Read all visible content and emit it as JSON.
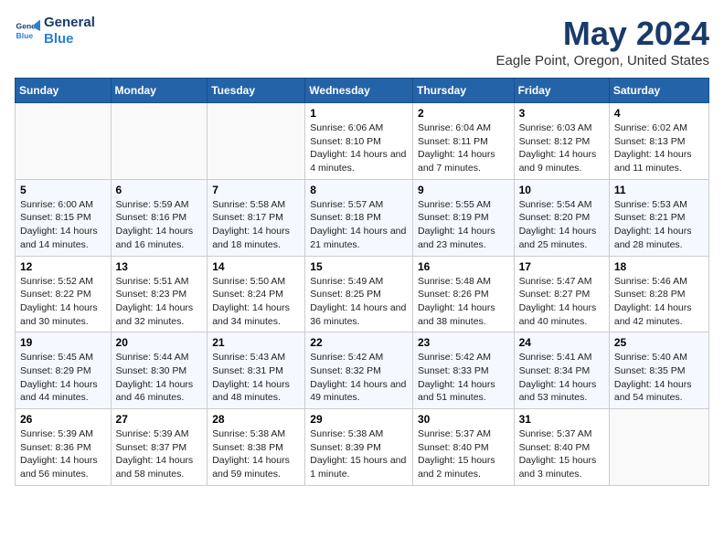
{
  "logo": {
    "line1": "General",
    "line2": "Blue"
  },
  "title": "May 2024",
  "subtitle": "Eagle Point, Oregon, United States",
  "days_header": [
    "Sunday",
    "Monday",
    "Tuesday",
    "Wednesday",
    "Thursday",
    "Friday",
    "Saturday"
  ],
  "weeks": [
    [
      {
        "day": "",
        "sunrise": "",
        "sunset": "",
        "daylight": ""
      },
      {
        "day": "",
        "sunrise": "",
        "sunset": "",
        "daylight": ""
      },
      {
        "day": "",
        "sunrise": "",
        "sunset": "",
        "daylight": ""
      },
      {
        "day": "1",
        "sunrise": "Sunrise: 6:06 AM",
        "sunset": "Sunset: 8:10 PM",
        "daylight": "Daylight: 14 hours and 4 minutes."
      },
      {
        "day": "2",
        "sunrise": "Sunrise: 6:04 AM",
        "sunset": "Sunset: 8:11 PM",
        "daylight": "Daylight: 14 hours and 7 minutes."
      },
      {
        "day": "3",
        "sunrise": "Sunrise: 6:03 AM",
        "sunset": "Sunset: 8:12 PM",
        "daylight": "Daylight: 14 hours and 9 minutes."
      },
      {
        "day": "4",
        "sunrise": "Sunrise: 6:02 AM",
        "sunset": "Sunset: 8:13 PM",
        "daylight": "Daylight: 14 hours and 11 minutes."
      }
    ],
    [
      {
        "day": "5",
        "sunrise": "Sunrise: 6:00 AM",
        "sunset": "Sunset: 8:15 PM",
        "daylight": "Daylight: 14 hours and 14 minutes."
      },
      {
        "day": "6",
        "sunrise": "Sunrise: 5:59 AM",
        "sunset": "Sunset: 8:16 PM",
        "daylight": "Daylight: 14 hours and 16 minutes."
      },
      {
        "day": "7",
        "sunrise": "Sunrise: 5:58 AM",
        "sunset": "Sunset: 8:17 PM",
        "daylight": "Daylight: 14 hours and 18 minutes."
      },
      {
        "day": "8",
        "sunrise": "Sunrise: 5:57 AM",
        "sunset": "Sunset: 8:18 PM",
        "daylight": "Daylight: 14 hours and 21 minutes."
      },
      {
        "day": "9",
        "sunrise": "Sunrise: 5:55 AM",
        "sunset": "Sunset: 8:19 PM",
        "daylight": "Daylight: 14 hours and 23 minutes."
      },
      {
        "day": "10",
        "sunrise": "Sunrise: 5:54 AM",
        "sunset": "Sunset: 8:20 PM",
        "daylight": "Daylight: 14 hours and 25 minutes."
      },
      {
        "day": "11",
        "sunrise": "Sunrise: 5:53 AM",
        "sunset": "Sunset: 8:21 PM",
        "daylight": "Daylight: 14 hours and 28 minutes."
      }
    ],
    [
      {
        "day": "12",
        "sunrise": "Sunrise: 5:52 AM",
        "sunset": "Sunset: 8:22 PM",
        "daylight": "Daylight: 14 hours and 30 minutes."
      },
      {
        "day": "13",
        "sunrise": "Sunrise: 5:51 AM",
        "sunset": "Sunset: 8:23 PM",
        "daylight": "Daylight: 14 hours and 32 minutes."
      },
      {
        "day": "14",
        "sunrise": "Sunrise: 5:50 AM",
        "sunset": "Sunset: 8:24 PM",
        "daylight": "Daylight: 14 hours and 34 minutes."
      },
      {
        "day": "15",
        "sunrise": "Sunrise: 5:49 AM",
        "sunset": "Sunset: 8:25 PM",
        "daylight": "Daylight: 14 hours and 36 minutes."
      },
      {
        "day": "16",
        "sunrise": "Sunrise: 5:48 AM",
        "sunset": "Sunset: 8:26 PM",
        "daylight": "Daylight: 14 hours and 38 minutes."
      },
      {
        "day": "17",
        "sunrise": "Sunrise: 5:47 AM",
        "sunset": "Sunset: 8:27 PM",
        "daylight": "Daylight: 14 hours and 40 minutes."
      },
      {
        "day": "18",
        "sunrise": "Sunrise: 5:46 AM",
        "sunset": "Sunset: 8:28 PM",
        "daylight": "Daylight: 14 hours and 42 minutes."
      }
    ],
    [
      {
        "day": "19",
        "sunrise": "Sunrise: 5:45 AM",
        "sunset": "Sunset: 8:29 PM",
        "daylight": "Daylight: 14 hours and 44 minutes."
      },
      {
        "day": "20",
        "sunrise": "Sunrise: 5:44 AM",
        "sunset": "Sunset: 8:30 PM",
        "daylight": "Daylight: 14 hours and 46 minutes."
      },
      {
        "day": "21",
        "sunrise": "Sunrise: 5:43 AM",
        "sunset": "Sunset: 8:31 PM",
        "daylight": "Daylight: 14 hours and 48 minutes."
      },
      {
        "day": "22",
        "sunrise": "Sunrise: 5:42 AM",
        "sunset": "Sunset: 8:32 PM",
        "daylight": "Daylight: 14 hours and 49 minutes."
      },
      {
        "day": "23",
        "sunrise": "Sunrise: 5:42 AM",
        "sunset": "Sunset: 8:33 PM",
        "daylight": "Daylight: 14 hours and 51 minutes."
      },
      {
        "day": "24",
        "sunrise": "Sunrise: 5:41 AM",
        "sunset": "Sunset: 8:34 PM",
        "daylight": "Daylight: 14 hours and 53 minutes."
      },
      {
        "day": "25",
        "sunrise": "Sunrise: 5:40 AM",
        "sunset": "Sunset: 8:35 PM",
        "daylight": "Daylight: 14 hours and 54 minutes."
      }
    ],
    [
      {
        "day": "26",
        "sunrise": "Sunrise: 5:39 AM",
        "sunset": "Sunset: 8:36 PM",
        "daylight": "Daylight: 14 hours and 56 minutes."
      },
      {
        "day": "27",
        "sunrise": "Sunrise: 5:39 AM",
        "sunset": "Sunset: 8:37 PM",
        "daylight": "Daylight: 14 hours and 58 minutes."
      },
      {
        "day": "28",
        "sunrise": "Sunrise: 5:38 AM",
        "sunset": "Sunset: 8:38 PM",
        "daylight": "Daylight: 14 hours and 59 minutes."
      },
      {
        "day": "29",
        "sunrise": "Sunrise: 5:38 AM",
        "sunset": "Sunset: 8:39 PM",
        "daylight": "Daylight: 15 hours and 1 minute."
      },
      {
        "day": "30",
        "sunrise": "Sunrise: 5:37 AM",
        "sunset": "Sunset: 8:40 PM",
        "daylight": "Daylight: 15 hours and 2 minutes."
      },
      {
        "day": "31",
        "sunrise": "Sunrise: 5:37 AM",
        "sunset": "Sunset: 8:40 PM",
        "daylight": "Daylight: 15 hours and 3 minutes."
      },
      {
        "day": "",
        "sunrise": "",
        "sunset": "",
        "daylight": ""
      }
    ]
  ]
}
